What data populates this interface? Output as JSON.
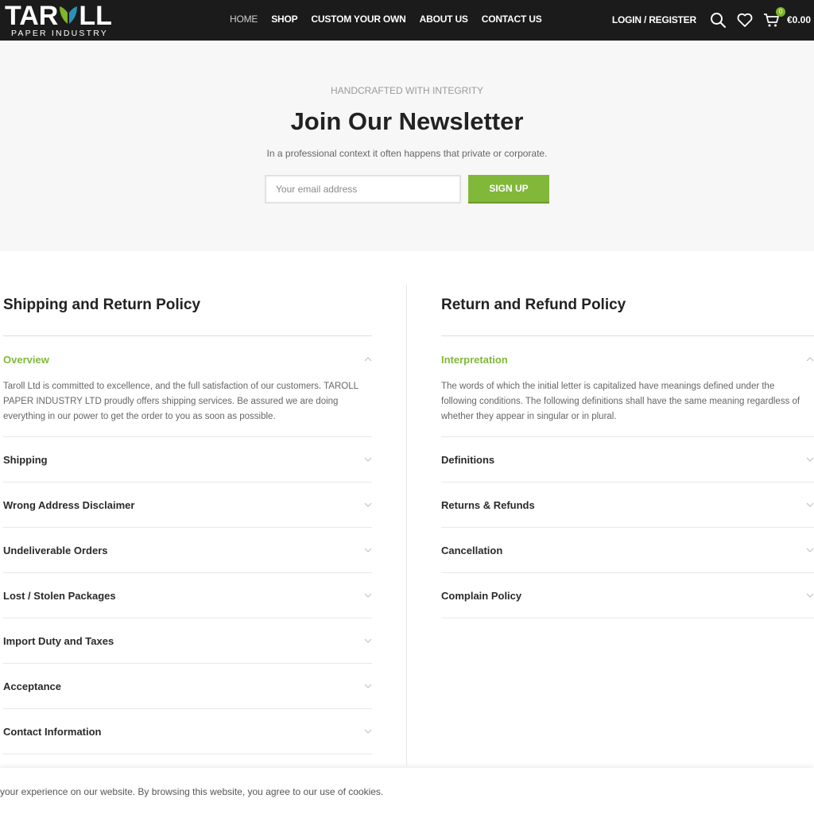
{
  "colors": {
    "accent": "#81b83a",
    "header_bg": "#1b1b1b",
    "newsletter_bg": "#f7f7f7"
  },
  "logo": {
    "word_left": "TAR",
    "word_right": "LL",
    "subtitle": "PAPER INDUSTRY"
  },
  "nav": [
    {
      "label": "HOME"
    },
    {
      "label": "SHOP"
    },
    {
      "label": "CUSTOM YOUR OWN"
    },
    {
      "label": "ABOUT US"
    },
    {
      "label": "CONTACT US"
    }
  ],
  "header": {
    "login_label": "LOGIN / REGISTER",
    "cart_count": "0",
    "cart_total": "€0.00",
    "icons": [
      "search-icon",
      "heart-icon",
      "cart-icon"
    ]
  },
  "newsletter": {
    "kicker": "HANDCRAFTED WITH INTEGRITY",
    "title": "Join Our Newsletter",
    "description": "In a professional context it often happens that private or corporate.",
    "email_placeholder": "Your email address",
    "button_label": "SIGN UP"
  },
  "shipping": {
    "title": "Shipping and Return Policy",
    "open_item": {
      "label": "Overview",
      "body": "Taroll Ltd is committed to excellence, and the full satisfaction of our customers. TAROLL PAPER INDUSTRY LTD   proudly offers shipping services. Be assured we are doing everything in our power to get the order to you as soon as possible."
    },
    "items": [
      {
        "label": "Shipping"
      },
      {
        "label": "Wrong Address Disclaimer"
      },
      {
        "label": "Undeliverable Orders"
      },
      {
        "label": "Lost / Stolen Packages"
      },
      {
        "label": "Import Duty and Taxes"
      },
      {
        "label": "Acceptance"
      },
      {
        "label": "Contact Information"
      }
    ]
  },
  "refund": {
    "title": "Return and Refund Policy",
    "open_item": {
      "label": "Interpretation",
      "body": "The words of which the initial letter is capitalized have meanings defined under the following conditions. The following definitions shall have the same meaning regardless of whether they appear in singular or in plural."
    },
    "items": [
      {
        "label": "Definitions"
      },
      {
        "label": "Returns & Refunds"
      },
      {
        "label": "Cancellation"
      },
      {
        "label": "Complain Policy"
      }
    ]
  },
  "cookie": {
    "text": "your experience on our website. By browsing this website, you agree to our use of cookies."
  }
}
